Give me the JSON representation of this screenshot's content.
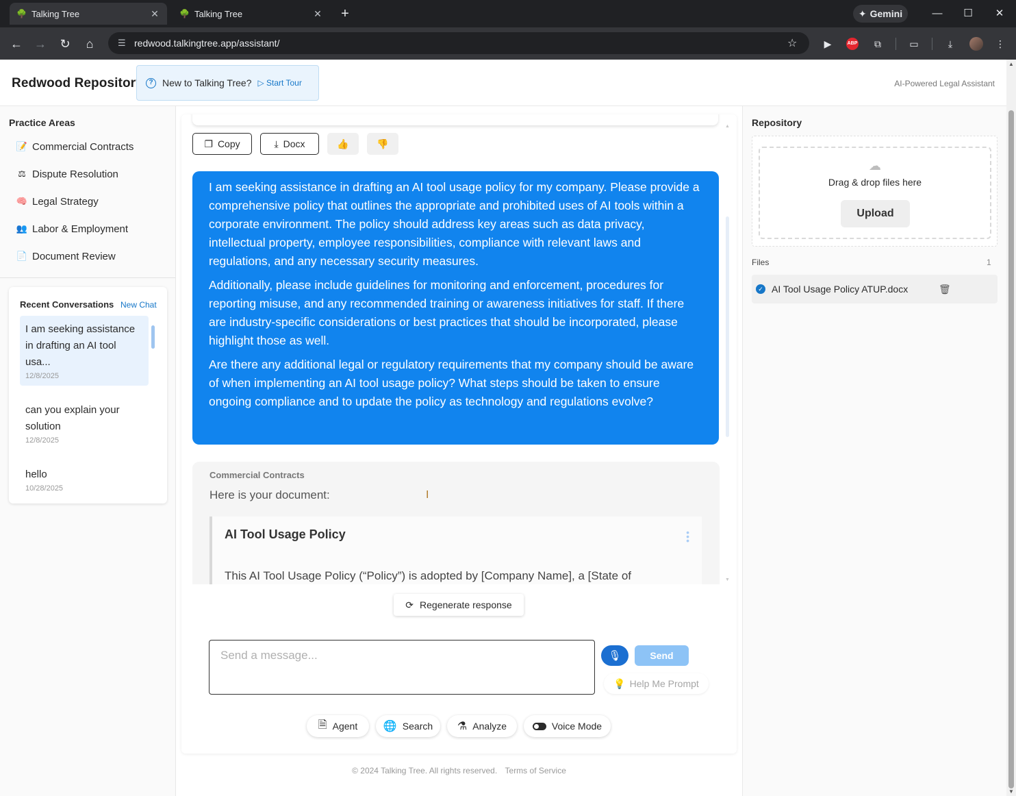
{
  "browser": {
    "tabs": [
      {
        "title": "Talking Tree",
        "active": true
      },
      {
        "title": "Talking Tree",
        "active": false
      }
    ],
    "new_tab_icon": "plus-icon",
    "gemini_label": "Gemini",
    "url": "redwood.talkingtree.app/assistant/",
    "extensions": [
      "extension-icon",
      "abp-icon",
      "puzzle-icon",
      "tab-search-icon",
      "download-icon",
      "profile-avatar",
      "menu-icon"
    ],
    "abp_text": "ABP"
  },
  "app": {
    "brand": "Redwood Repository",
    "tour": {
      "question": "New to Talking Tree?",
      "start": "Start Tour"
    },
    "tagline": "AI-Powered Legal Assistant",
    "accent_color": "#1184ee"
  },
  "practice": {
    "title": "Practice Areas",
    "items": [
      {
        "label": "Commercial Contracts",
        "icon": "contract-icon",
        "glyph": "📝"
      },
      {
        "label": "Dispute Resolution",
        "icon": "scales-icon",
        "glyph": "⚖"
      },
      {
        "label": "Legal Strategy",
        "icon": "brain-icon",
        "glyph": "🧠"
      },
      {
        "label": "Labor & Employment",
        "icon": "people-icon",
        "glyph": "👥"
      },
      {
        "label": "Document Review",
        "icon": "document-icon",
        "glyph": "📄"
      }
    ]
  },
  "recent": {
    "title": "Recent Conversations",
    "new_chat": "New Chat",
    "items": [
      {
        "title": "I am seeking assistance in drafting an AI tool usa...",
        "date": "12/8/2025",
        "selected": true
      },
      {
        "title": "can you explain your solution",
        "date": "12/8/2025",
        "selected": false
      },
      {
        "title": "hello",
        "date": "10/28/2025",
        "selected": false
      }
    ]
  },
  "chat": {
    "actions": {
      "copy": "Copy",
      "docx": "Docx"
    },
    "user_message": [
      "I am seeking assistance in drafting an AI tool usage policy for my company. Please provide a comprehensive policy that outlines the appropriate and prohibited uses of AI tools within a corporate environment. The policy should address key areas such as data privacy, intellectual property, employee responsibilities, compliance with relevant laws and regulations, and any necessary security measures.",
      "Additionally, please include guidelines for monitoring and enforcement, procedures for reporting misuse, and any recommended training or awareness initiatives for staff. If there are industry-specific considerations or best practices that should be incorporated, please highlight those as well.",
      "Are there any additional legal or regulatory requirements that my company should be aware of when implementing an AI tool usage policy? What steps should be taken to ensure ongoing compliance and to update the policy as technology and regulations evolve?"
    ],
    "response": {
      "area": "Commercial Contracts",
      "intro": "Here is your document:",
      "doc_title": "AI Tool Usage Policy",
      "doc_body": "This AI Tool Usage Policy (“Policy”) is adopted by [Company Name], a [State of"
    },
    "regenerate": "Regenerate response",
    "input_placeholder": "Send a message...",
    "send": "Send",
    "help_prompt": "Help Me Prompt",
    "tools": [
      {
        "label": "Agent",
        "icon": "agent-icon"
      },
      {
        "label": "Search",
        "icon": "globe-icon"
      },
      {
        "label": "Analyze",
        "icon": "flask-icon"
      },
      {
        "label": "Voice Mode",
        "icon": "toggle-icon"
      }
    ]
  },
  "footer": {
    "copyright": "© 2024 Talking Tree. All rights reserved.",
    "terms": "Terms of Service"
  },
  "repository": {
    "title": "Repository",
    "drop_text": "Drag & drop files here",
    "upload": "Upload",
    "files_label": "Files",
    "files_count": "1",
    "files": [
      {
        "name": "AI Tool Usage Policy ATUP.docx"
      }
    ]
  }
}
